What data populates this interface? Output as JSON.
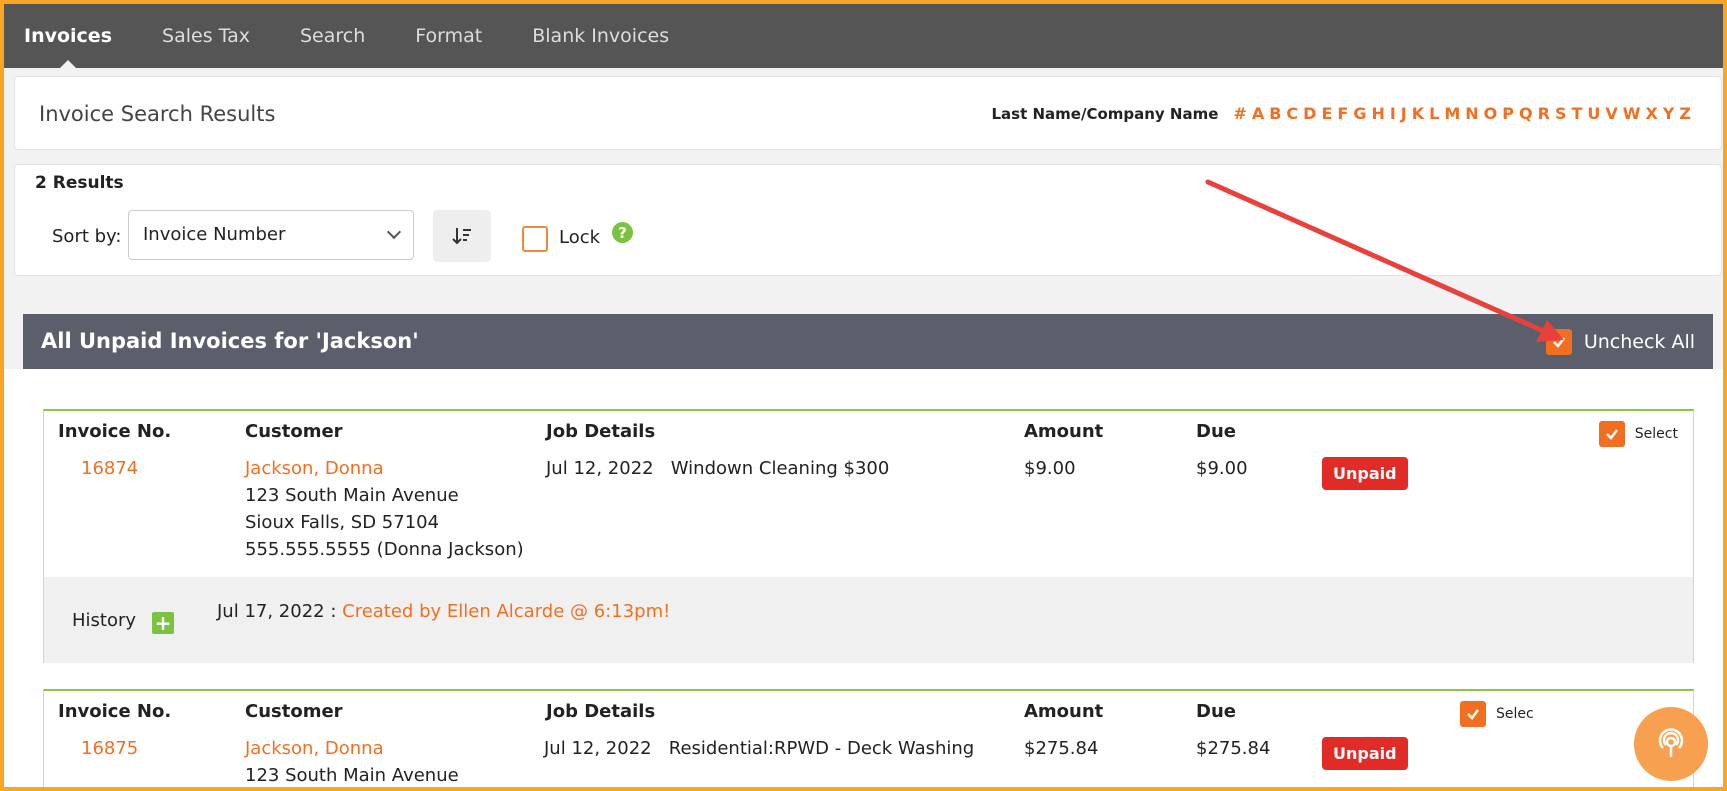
{
  "nav": {
    "tabs": [
      {
        "label": "Invoices",
        "active": true
      },
      {
        "label": "Sales Tax"
      },
      {
        "label": "Search"
      },
      {
        "label": "Format"
      },
      {
        "label": "Blank Invoices"
      }
    ]
  },
  "header": {
    "title": "Invoice Search Results",
    "filter_label": "Last Name/Company Name",
    "letters": [
      "#",
      "A",
      "B",
      "C",
      "D",
      "E",
      "F",
      "G",
      "H",
      "I",
      "J",
      "K",
      "L",
      "M",
      "N",
      "O",
      "P",
      "Q",
      "R",
      "S",
      "T",
      "U",
      "V",
      "W",
      "X",
      "Y",
      "Z"
    ]
  },
  "controls": {
    "results_count": "2 Results",
    "sort_label": "Sort by:",
    "sort_value": "Invoice Number",
    "lock_label": "Lock",
    "help_glyph": "?"
  },
  "section": {
    "title": "All Unpaid Invoices for 'Jackson'",
    "uncheck_all_label": "Uncheck All"
  },
  "columns": {
    "invoice_no": "Invoice No.",
    "customer": "Customer",
    "job_details": "Job Details",
    "amount": "Amount",
    "due": "Due",
    "select": "Select"
  },
  "invoices": [
    {
      "number": "16874",
      "customer_name": "Jackson, Donna",
      "address1": "123 South Main Avenue",
      "address2": "Sioux Falls, SD 57104",
      "phone": "555.555.5555 (Donna Jackson)",
      "job_date": "Jul 12, 2022",
      "job_desc": "Windown Cleaning $300",
      "amount": "$9.00",
      "due": "$9.00",
      "status": "Unpaid",
      "history_label": "History",
      "history_date": "Jul 17, 2022 :",
      "history_text": "Created by Ellen Alcarde @ 6:13pm!"
    },
    {
      "number": "16875",
      "customer_name": "Jackson, Donna",
      "address1": "123 South Main Avenue",
      "job_date": "Jul 12, 2022",
      "job_desc": "Residential:RPWD - Deck Washing",
      "amount": "$275.84",
      "due": "$275.84",
      "status": "Unpaid",
      "select_label": "Selec"
    }
  ],
  "colors": {
    "accent": "#f26f21",
    "nav_bg": "#555555",
    "section_bg": "#5b5e6b",
    "unpaid": "#e02b27",
    "green": "#7cc242",
    "annotation": "#e8413c"
  },
  "icons": {
    "sort_direction": "sort-descending-icon",
    "help": "help-icon",
    "history_add": "plus-icon",
    "fab": "broadcast-icon"
  }
}
